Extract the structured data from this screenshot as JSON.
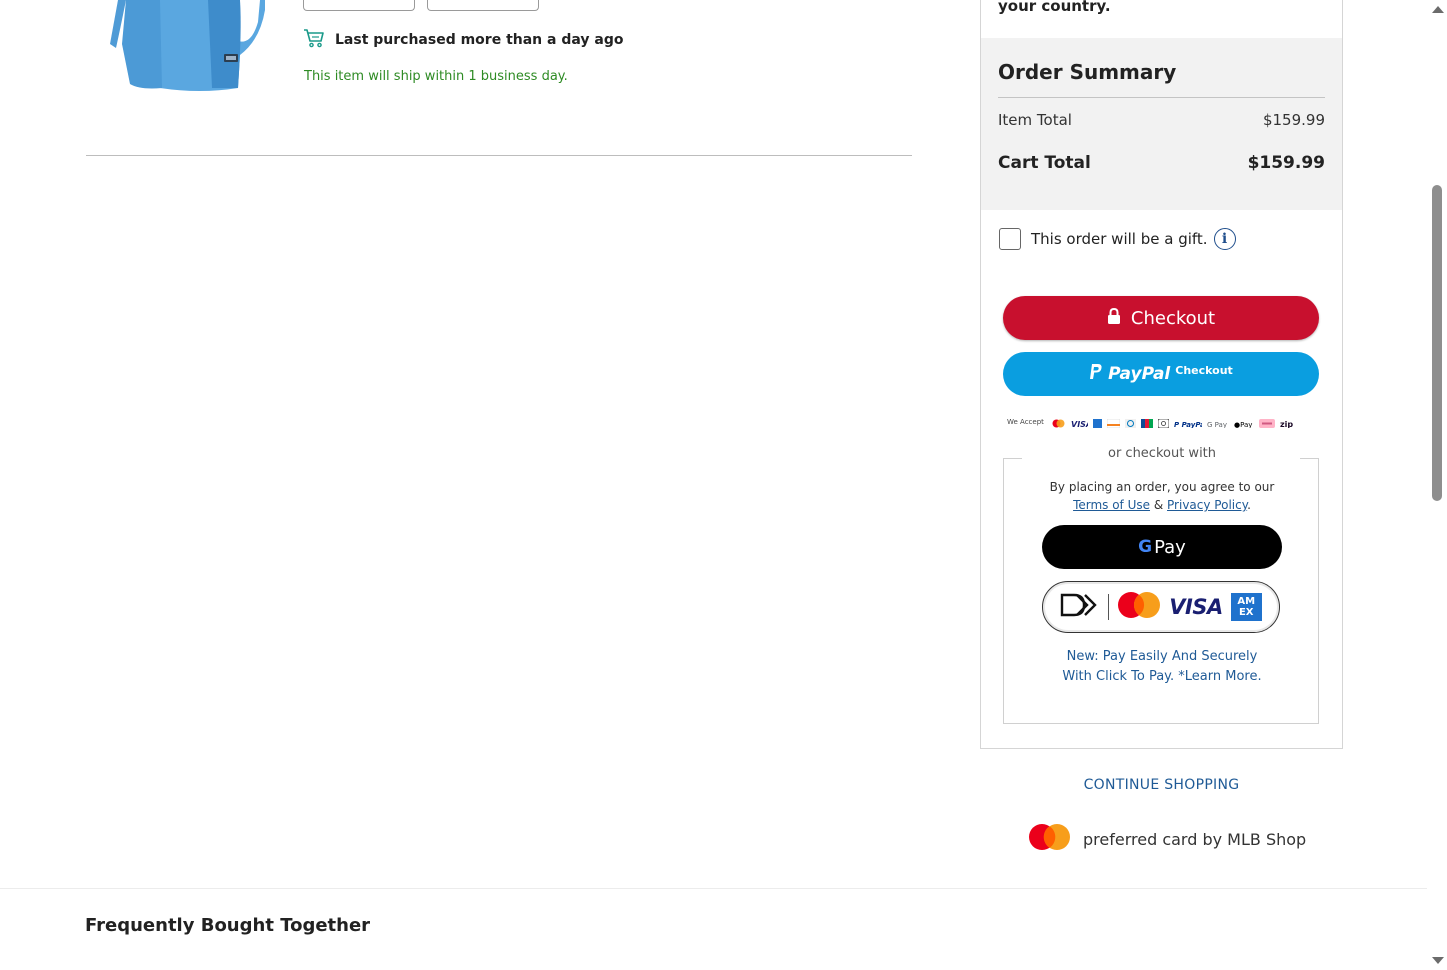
{
  "cart_item": {
    "image_alt": "Light blue jersey",
    "purchase_note": "Last purchased more than a day ago",
    "ship_note": "This item will ship within 1 business day."
  },
  "summary": {
    "country_note": "your country.",
    "title": "Order Summary",
    "item_total_label": "Item Total",
    "item_total_value": "$159.99",
    "cart_total_label": "Cart Total",
    "cart_total_value": "$159.99",
    "gift_label": "This order will be a gift.",
    "gift_checked": false,
    "checkout_label": "Checkout",
    "paypal_word": "PayPal",
    "paypal_checkout": "Checkout",
    "we_accept": "We Accept"
  },
  "alt_checkout": {
    "legend": "or checkout with",
    "agree_prefix": "By placing an order, you agree to our",
    "terms_link": "Terms of Use",
    "and": "&",
    "privacy_link": "Privacy Policy",
    "period": ".",
    "gpay_g": "G",
    "gpay_label": "Pay",
    "visa": "VISA",
    "amex_top": "AM",
    "amex_bottom": "EX",
    "learn_more": "New: Pay Easily And Securely With Click To Pay. *Learn More."
  },
  "continue_shopping": "CONTINUE SHOPPING",
  "preferred_card": "preferred card by MLB Shop",
  "frequently_bought": "Frequently Bought Together",
  "colors": {
    "checkout_red": "#c8102e",
    "paypal_blue": "#0a9ee0",
    "link_blue": "#1f5a96",
    "ship_green": "#2e8b24"
  }
}
